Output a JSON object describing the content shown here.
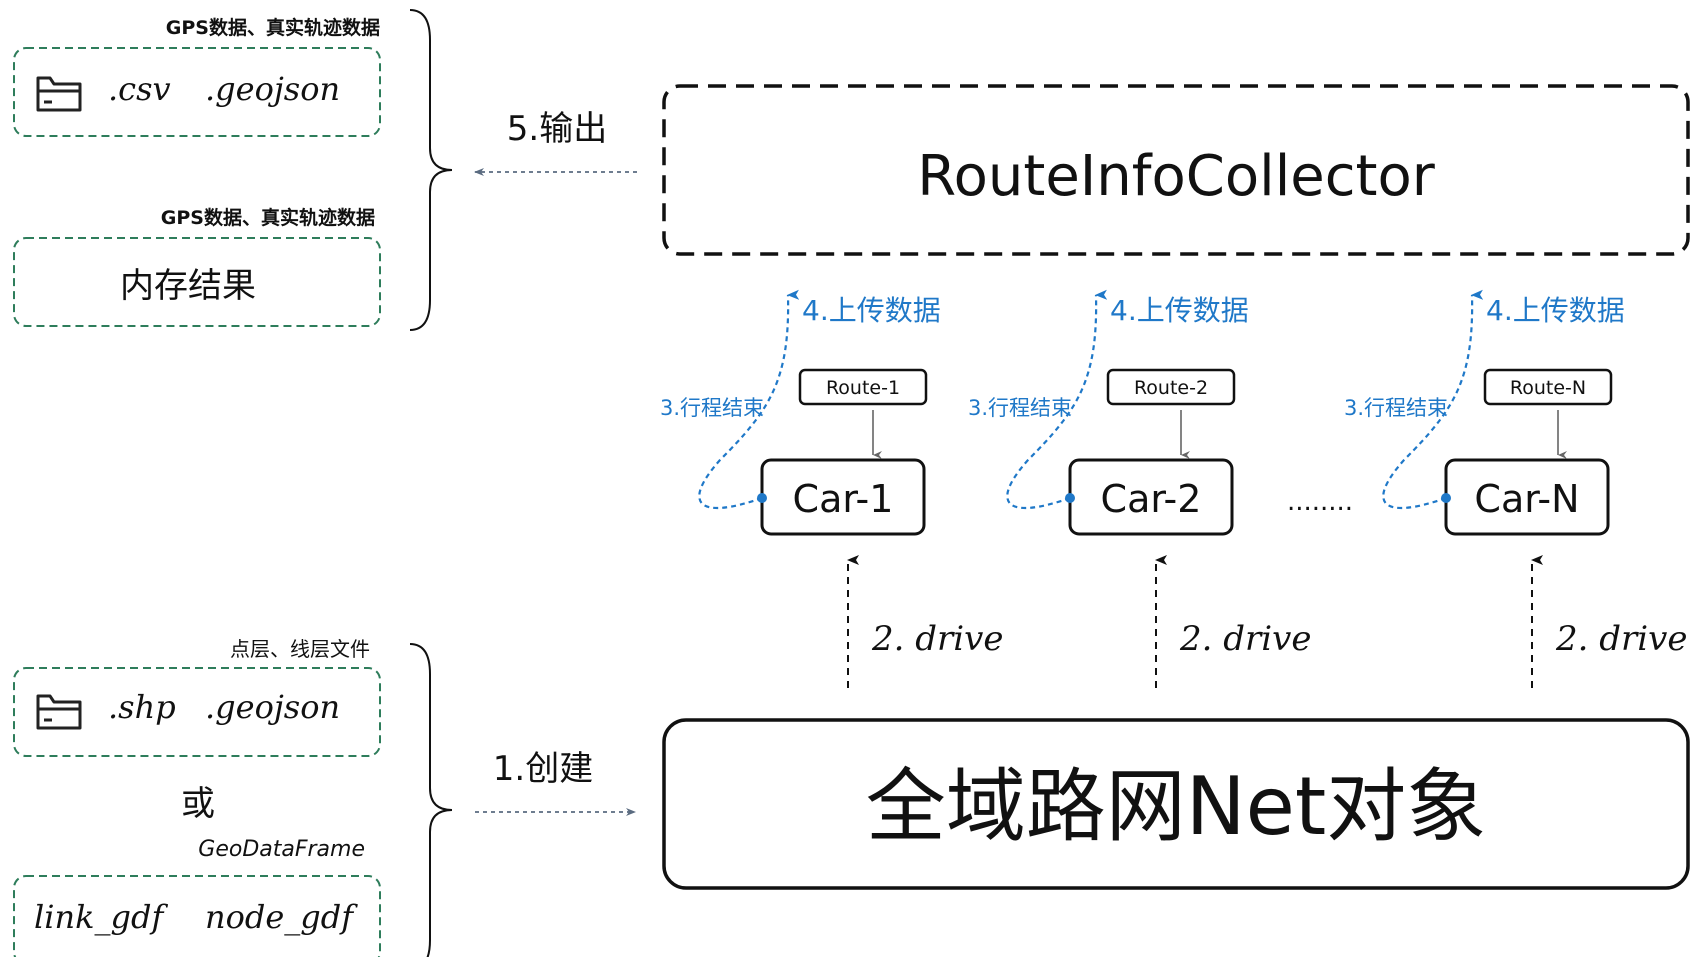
{
  "left_panel": {
    "top_caption": "GPS数据、真实轨迹数据",
    "top_box": {
      "ext1": ".csv",
      "ext2": ".geojson"
    },
    "mid_caption": "GPS数据、真实轨迹数据",
    "mid_box_label": "内存结果",
    "bottom_caption": "点层、线层文件",
    "bottom_box": {
      "ext1": ".shp",
      "ext2": ".geojson"
    },
    "or_label": "或",
    "gdf_caption": "GeoDataFrame",
    "gdf_box": {
      "item1": "link_gdf",
      "item2": "node_gdf"
    }
  },
  "arrows": {
    "output_label": "5.输出",
    "create_label": "1.创建"
  },
  "collector": {
    "title": "RouteInfoCollector"
  },
  "net": {
    "title": "全域路网Net对象"
  },
  "cars": [
    {
      "car": "Car-1",
      "route": "Route-1",
      "upload": "4.上传数据",
      "trip_end": "3.行程结束",
      "drive": "2. drive"
    },
    {
      "car": "Car-2",
      "route": "Route-2",
      "upload": "4.上传数据",
      "trip_end": "3.行程结束",
      "drive": "2. drive"
    },
    {
      "car": "Car-N",
      "route": "Route-N",
      "upload": "4.上传数据",
      "trip_end": "3.行程结束",
      "drive": "2. drive"
    }
  ],
  "ellipsis": "........",
  "colors": {
    "green_dash": "#2e7d5b",
    "blue": "#1f78c8",
    "arrow_grey": "#6b7a8f"
  }
}
